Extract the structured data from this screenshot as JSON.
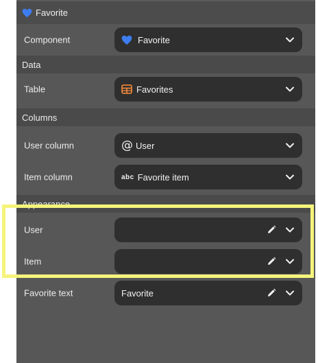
{
  "header": {
    "title": "Favorite",
    "icon": "heart-icon",
    "icon_color": "#3d7df0"
  },
  "component": {
    "label": "Component",
    "value": "Favorite",
    "icon": "heart-icon"
  },
  "sections": {
    "data": "Data",
    "columns": "Columns",
    "appearance": "Appearance"
  },
  "table": {
    "label": "Table",
    "value": "Favorites",
    "icon": "table-icon",
    "icon_color": "#e8833a"
  },
  "user_column": {
    "label": "User column",
    "value": "User",
    "icon": "at-icon"
  },
  "item_column": {
    "label": "Item column",
    "value": "Favorite item",
    "icon": "text-abc-icon",
    "icon_text": "abc"
  },
  "appearance": {
    "user": {
      "label": "User",
      "value": ""
    },
    "item": {
      "label": "Item",
      "value": ""
    },
    "favorite_text": {
      "label": "Favorite text",
      "value": "Favorite"
    }
  },
  "colors": {
    "panel": "#575757",
    "section": "#4a4a4a",
    "control": "#2f2f2f",
    "highlight": "#f6f47a"
  }
}
